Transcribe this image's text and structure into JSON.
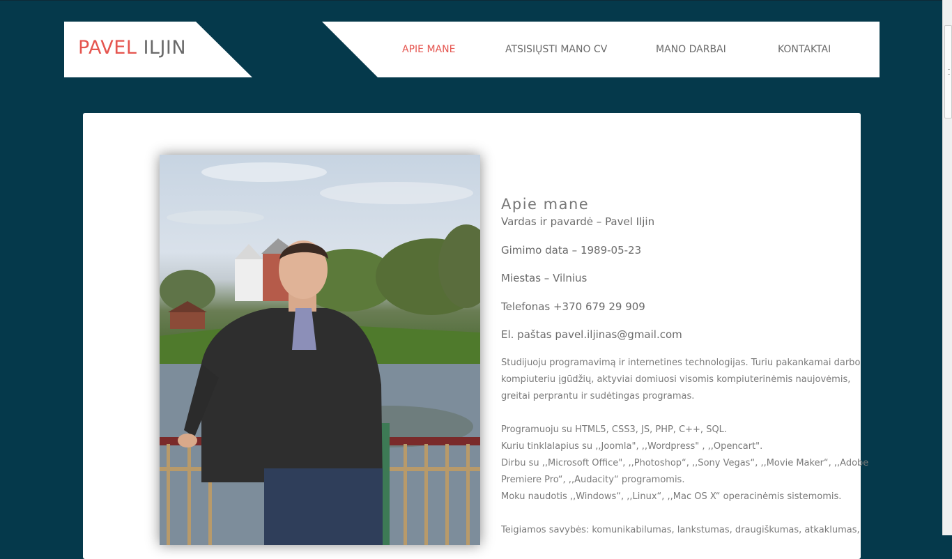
{
  "logo": {
    "first": "PAVEL",
    "last": "ILJIN"
  },
  "nav": {
    "items": [
      {
        "label": "APIE MANE",
        "active": true
      },
      {
        "label": "ATSISIŲSTI MANO CV",
        "active": false
      },
      {
        "label": "MANO DARBAI",
        "active": false
      },
      {
        "label": "KONTAKTAI",
        "active": false
      }
    ]
  },
  "about": {
    "title": "Apie mane",
    "name_line": "Vardas ir pavardė – Pavel Iljin",
    "birth_line": "Gimimo data – 1989-05-23",
    "city_line": "Miestas – Vilnius",
    "phone_line": "Telefonas +370 679 29 909",
    "email_line": "El. paštas pavel.iljinas@gmail.com",
    "para1": [
      "Studijuoju programavimą ir internetines technologijas. Turiu pakankamai darbo",
      "kompiuteriu įgūdžių, aktyviai domiuosi visomis kompiuterinėmis naujovėmis,",
      "greitai perprantu ir sudėtingas programas."
    ],
    "para2": [
      "Programuoju su HTML5, CSS3, JS, PHP, C++, SQL.",
      "Kuriu tinklalapius su ,,Joomla\", ,,Wordpress\" , ,,Opencart\".",
      "Dirbu su ,,Microsoft Office\", ,,Photoshop“, ,,Sony Vegas“, ,,Movie Maker“, ,,Adobe",
      "Premiere Pro“, ,,Audacity“ programomis.",
      "Moku naudotis ,,Windows“, ,,Linux“, ,,Mac OS X“ operacinėmis sistemomis."
    ],
    "para3": [
      "Teigiamos savybės: komunikabilumas, lankstumas, draugiškumas, atkaklumas,"
    ]
  },
  "colors": {
    "background": "#05394b",
    "accent": "#e5554f",
    "text": "#6b6b6b"
  }
}
